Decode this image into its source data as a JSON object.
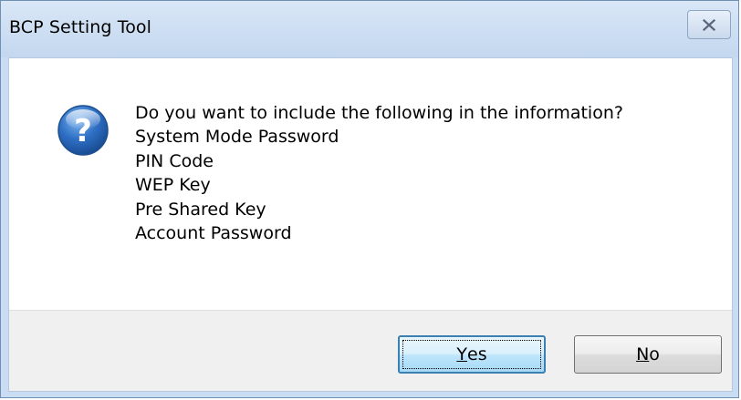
{
  "window": {
    "title": "BCP Setting Tool",
    "close_icon": "close-icon"
  },
  "message": {
    "icon": "question-icon",
    "lines": [
      "Do you want to include the following in the information?",
      "System Mode Password",
      "PIN Code",
      "WEP Key",
      "Pre Shared Key",
      "Account Password"
    ]
  },
  "buttons": {
    "yes": {
      "mnemonic": "Y",
      "rest": "es"
    },
    "no": {
      "mnemonic": "N",
      "rest": "o"
    }
  },
  "colors": {
    "title_bar": "#c9dcf2",
    "default_button_border": "#3c7fb1",
    "icon_blue": "#2a6cc0"
  }
}
